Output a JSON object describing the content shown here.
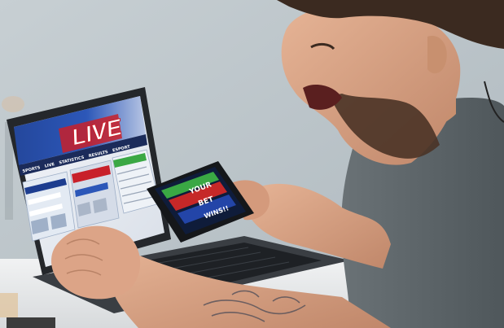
{
  "laptop_screen": {
    "banner_text": "LIVE",
    "nav_items": [
      "SPORTS",
      "LIVE",
      "STATISTICS",
      "RESULTS",
      "ESPORT"
    ]
  },
  "phone_screen": {
    "line1": "YOUR",
    "line2": "BET",
    "line3": "WINS!!"
  },
  "colors": {
    "wall": "#b9c2c7",
    "desk": "#e9ebec",
    "shirt": "#5c6468",
    "skin": "#d9a183",
    "beard": "#4a3326",
    "laptop_body": "#2a2d31",
    "banner_red": "#c8202a",
    "banner_blue": "#1d3d8f",
    "phone_green": "#3aa844",
    "phone_red": "#c62828",
    "phone_blue": "#2345a8"
  }
}
